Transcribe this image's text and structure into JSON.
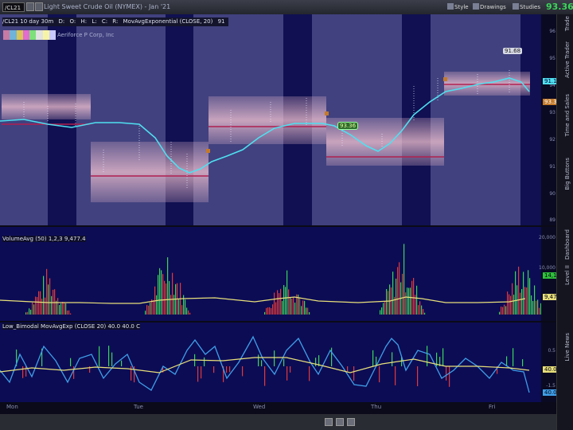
{
  "titlebar": {
    "symbol": "/CL21",
    "title": "Light Sweet Crude Oil (NYMEX) - Jan '21",
    "toolbar": [
      {
        "icon": "style-icon",
        "label": "Style"
      },
      {
        "icon": "drawings-icon",
        "label": "Drawings"
      },
      {
        "icon": "studies-icon",
        "label": "Studies"
      }
    ],
    "last_price": "93.36"
  },
  "infobar": {
    "items": [
      "/CL21 10 day 30m",
      "D:",
      "O:",
      "H:",
      "L:",
      "C:",
      "R:",
      "MovAvgExponential (CLOSE, 20)",
      "91"
    ]
  },
  "company": "Aeriforce P Corp, Inc",
  "color_swatches": [
    "#c77aa4",
    "#6fb3d8",
    "#d9c55a",
    "#e26cd0",
    "#7de07a",
    "#e2e2e2",
    "#f7f3a6",
    "#c9c9ff"
  ],
  "price_axis": {
    "ticks": [
      "96",
      "95",
      "94",
      "93",
      "92",
      "91",
      "90",
      "89"
    ]
  },
  "price_labels": [
    {
      "text": "91.68",
      "kind": "callout"
    },
    {
      "text": "91.1",
      "kind": "cyan"
    },
    {
      "text": "93.36",
      "kind": "last"
    },
    {
      "text": "93.36",
      "kind": "tag"
    }
  ],
  "volume_pane": {
    "label_items": [
      "VolumeAvg (50)",
      "1,2,3",
      "9,477.4"
    ],
    "ticks": [
      "20,000",
      "10,000"
    ],
    "values": [
      "14,112",
      "9,477.4"
    ]
  },
  "osc_pane": {
    "label_items": [
      "Low_Bimodal",
      "MovAvgExp (CLOSE 20)",
      "40.0",
      "40.0",
      "C"
    ],
    "ticks": [
      "0.5",
      "-0.5",
      "-1.5"
    ],
    "values": [
      "40.0",
      "40.0"
    ]
  },
  "xaxis": {
    "labels": [
      "Mon",
      "Tue",
      "Wed",
      "Thu",
      "Fri"
    ]
  },
  "side_tabs": [
    "Trade",
    "Active Trader",
    "Time and Sales",
    "Big Buttons",
    "Level II",
    "Dashboard",
    "Live News"
  ]
}
